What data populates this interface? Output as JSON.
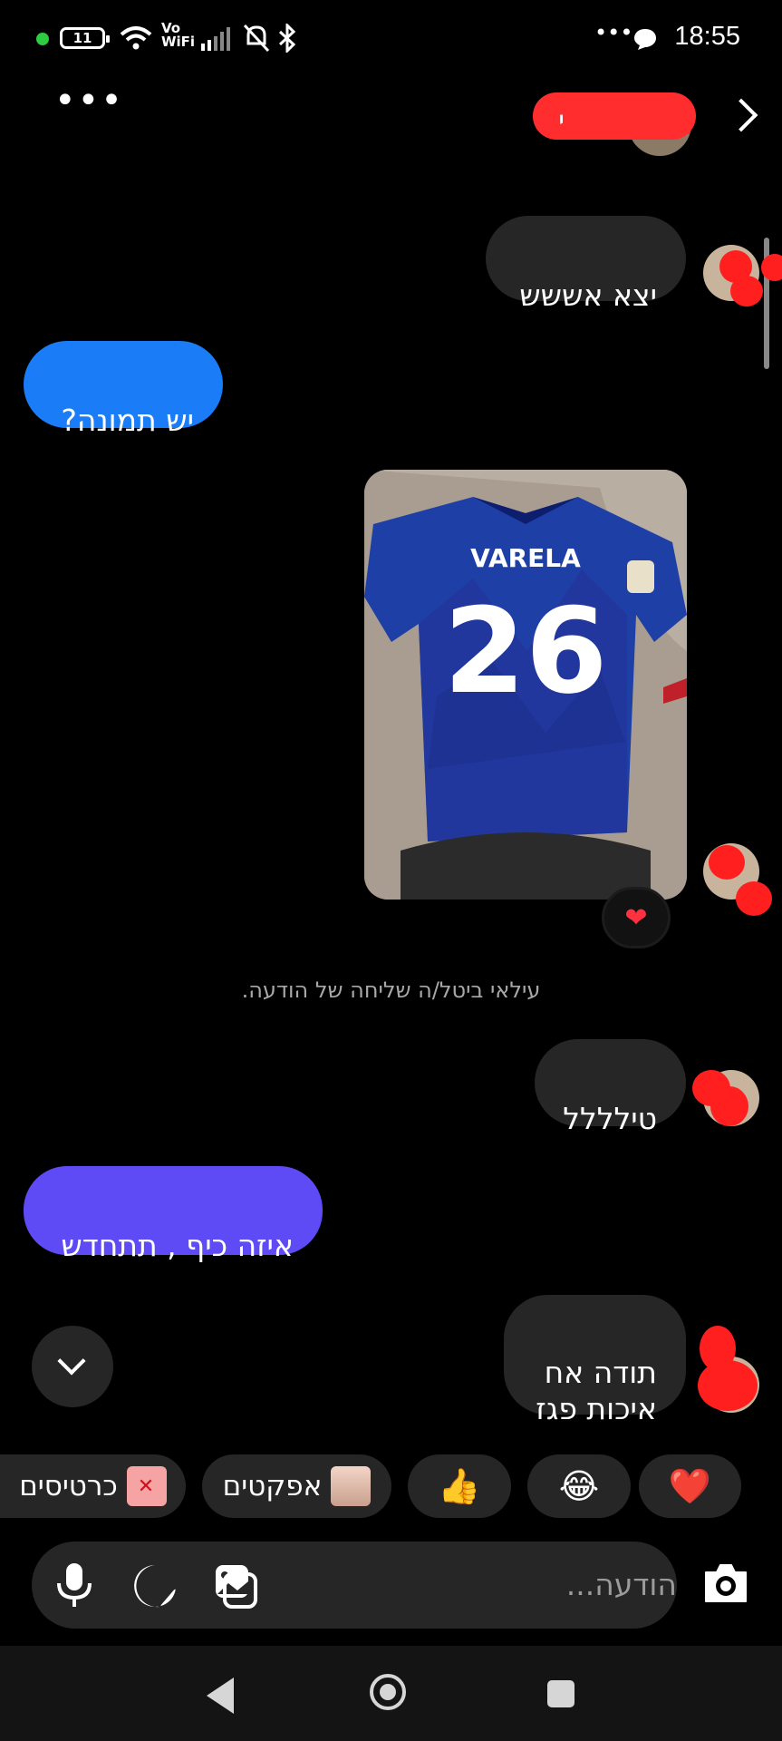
{
  "status_bar": {
    "battery": "11",
    "network_label_top": "Vo",
    "network_label_bottom": "WiFi",
    "time": "18:55",
    "more": "•••",
    "icons": [
      "wifi-icon",
      "signal-icon",
      "mute-icon",
      "bluetooth-icon",
      "chat-icon"
    ]
  },
  "header": {
    "more": "•••",
    "name_visible_char": "י"
  },
  "messages": [
    {
      "from": "them",
      "text": "יצא אששש"
    },
    {
      "from": "me",
      "text": "יש תמונה?",
      "color": "#1b7cf7"
    },
    {
      "from": "them",
      "type": "image",
      "jersey_name": "VARELA",
      "jersey_number": "26",
      "reaction": "❤"
    },
    {
      "from": "system",
      "text": "עילאי ביטל/ה שליחה של הודעה."
    },
    {
      "from": "them",
      "text": "טילללל"
    },
    {
      "from": "me",
      "text": "איזה כיף , תתחדש",
      "color": "#5f4bf5"
    },
    {
      "from": "them",
      "text": "תודה אח\nאיכות פגז"
    }
  ],
  "quick_actions": [
    {
      "label": "",
      "emoji": "❤️"
    },
    {
      "label": "",
      "emoji": "😂"
    },
    {
      "label": "",
      "emoji": "👍"
    },
    {
      "label": "אפקטים",
      "icon": "effects-thumbnail"
    },
    {
      "label": "כרטיסים",
      "icon": "gift-card-icon"
    }
  ],
  "composer": {
    "placeholder": "הודעה...",
    "icons": [
      "camera-icon",
      "gallery-icon",
      "sticker-icon",
      "microphone-icon"
    ]
  },
  "colors": {
    "background": "#000000",
    "incoming_bubble": "#262626",
    "outgoing_blue": "#1b7cf7",
    "outgoing_purple": "#5f4bf5",
    "like_red": "#ff3040"
  }
}
